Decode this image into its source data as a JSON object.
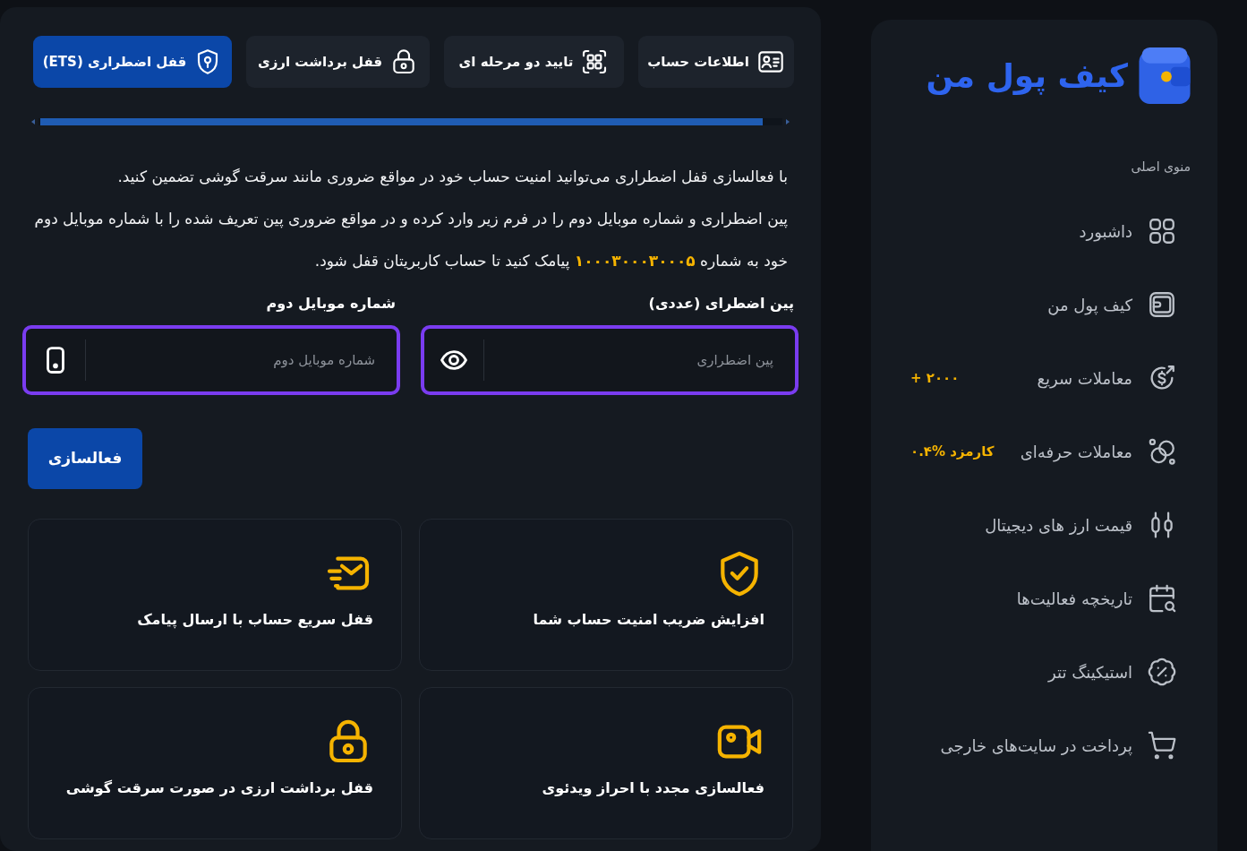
{
  "sidebar": {
    "logo": "کیف پول من",
    "section_title": "منوی اصلی",
    "items": [
      {
        "label": "داشبورد"
      },
      {
        "label": "کیف پول من"
      },
      {
        "label": "معاملات سریع",
        "badge": "+ ۲۰۰۰"
      },
      {
        "label": "معاملات حرفه‌ای",
        "badge": "کارمزد %۰.۴"
      },
      {
        "label": "قیمت ارز های دیجیتال"
      },
      {
        "label": "تاریخچه فعالیت‌ها"
      },
      {
        "label": "استیکینگ تتر"
      },
      {
        "label": "پرداخت در سایت‌های خارجی"
      }
    ]
  },
  "main": {
    "tabs": [
      {
        "label": "اطلاعات حساب",
        "selected": false
      },
      {
        "label": "تایید دو مرحله ای",
        "selected": false
      },
      {
        "label": "قفل برداشت ارزی",
        "selected": false
      },
      {
        "label": "قفل اضطراری (ETS)",
        "selected": true
      }
    ],
    "intro": {
      "paragraph": "با فعالسازی قفل اضطراری می‌توانید امنیت حساب خود در مواقع ضروری مانند سرقت گوشی تضمین کنید.",
      "instruction": {
        "before": "پین اضطراری و شماره موبایل دوم را در فرم زیر وارد کرده و در مواقع ضروری پین تعریف شده را با شماره موبایل دوم خود به شماره",
        "number": "۱۰۰۰۳۰۰۰۳۰۰۰۵",
        "after": "پیامک کنید تا حساب کاربریتان قفل شود."
      }
    },
    "fields": [
      {
        "label": "پین اضطرای (عددی)",
        "placeholder": "پین اضطراری"
      },
      {
        "label": "شماره موبایل دوم",
        "placeholder": "شماره موبایل دوم"
      }
    ],
    "submit_button": "فعالسازی",
    "features": [
      {
        "text": "افزایش ضریب امنیت حساب شما"
      },
      {
        "text": "قفل سریع حساب با ارسال پیامک"
      },
      {
        "text": "فعالسازی مجدد با احراز ویدئوی"
      },
      {
        "text": "قفل برداشت ارزی در صورت سرقت گوشی"
      }
    ]
  }
}
